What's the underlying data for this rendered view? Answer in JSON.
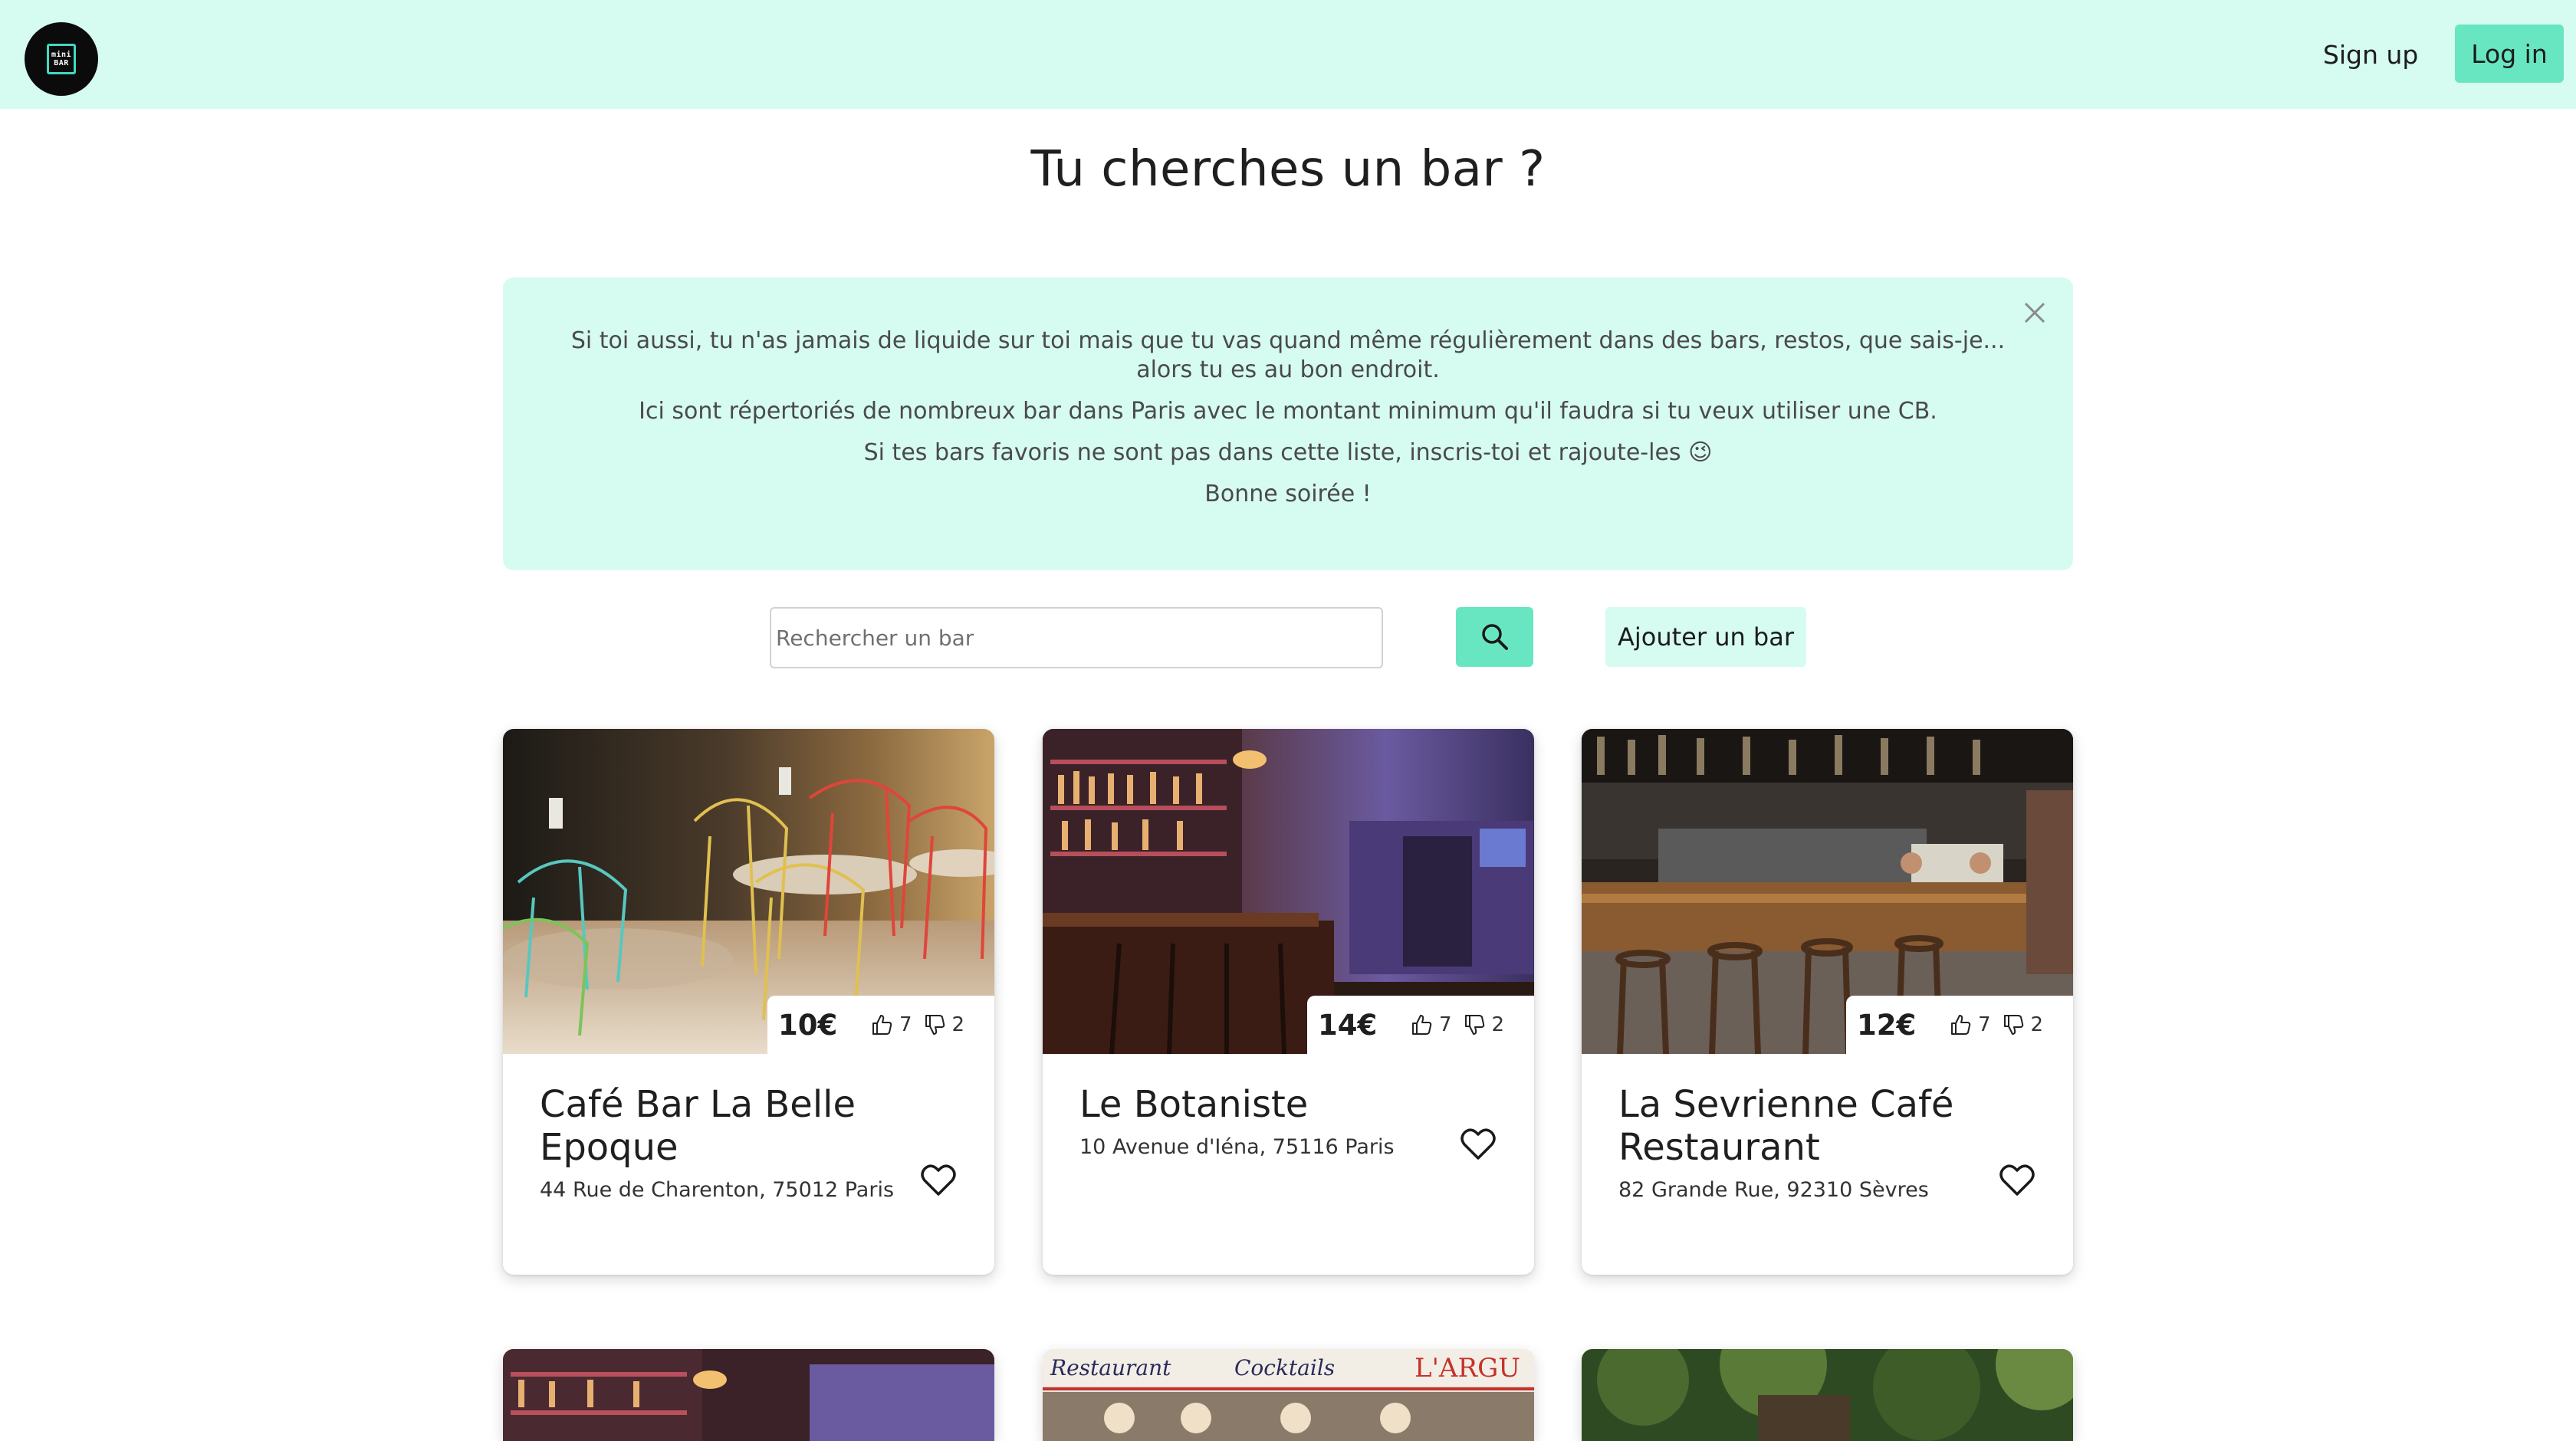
{
  "navbar": {
    "logo_line1": "mini",
    "logo_line2": "BAR",
    "signup_label": "Sign up",
    "login_label": "Log in"
  },
  "page": {
    "title": "Tu cherches un bar ?"
  },
  "info": {
    "paragraphs": [
      "Si toi aussi, tu n'as jamais de liquide sur toi mais que tu vas quand même régulièrement dans des bars, restos, que sais-je... alors tu es au bon endroit.",
      "Ici sont répertoriés de nombreux bar dans Paris avec le montant minimum qu'il faudra si tu veux utiliser une CB.",
      "Si tes bars favoris ne sont pas dans cette liste, inscris-toi et rajoute-les 😉",
      "Bonne soirée !"
    ]
  },
  "search": {
    "placeholder": "Rechercher un bar",
    "add_label": "Ajouter un bar"
  },
  "bars": [
    {
      "name": "Café Bar La Belle Epoque",
      "address": "44 Rue de Charenton, 75012 Paris",
      "price": "10€",
      "likes": "7",
      "dislikes": "2"
    },
    {
      "name": "Le Botaniste",
      "address": "10 Avenue d'Iéna, 75116 Paris",
      "price": "14€",
      "likes": "7",
      "dislikes": "2"
    },
    {
      "name": "La Sevrienne Café Restaurant",
      "address": "82 Grande Rue, 92310 Sèvres",
      "price": "12€",
      "likes": "7",
      "dislikes": "2"
    }
  ],
  "partial_card_sign": {
    "left_word": "Restaurant",
    "middle_word": "Cocktails",
    "right_word": "L'ARGU"
  },
  "colors": {
    "mint_light": "#d6fbf0",
    "mint": "#68e6c1",
    "text": "#1f1f1f"
  }
}
